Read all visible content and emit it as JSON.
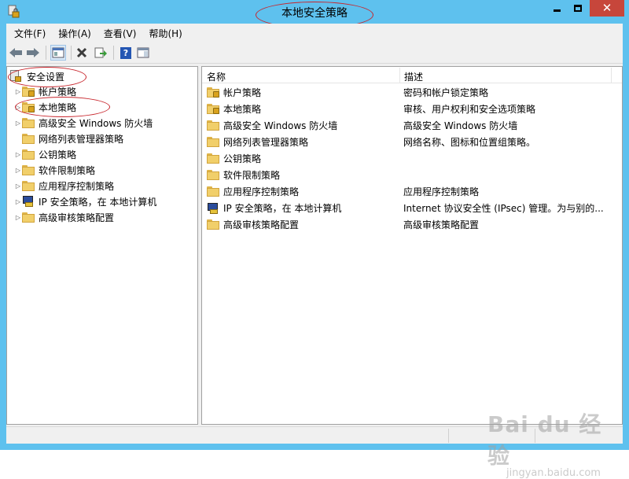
{
  "window": {
    "title": "本地安全策略",
    "close_glyph": "✕"
  },
  "menu": {
    "items": [
      "文件(F)",
      "操作(A)",
      "查看(V)",
      "帮助(H)"
    ]
  },
  "toolbar": {
    "icons": [
      "back-arrow-icon",
      "forward-arrow-icon",
      "show-hide-tree-icon",
      "delete-icon",
      "export-list-icon",
      "help-icon",
      "properties-icon"
    ],
    "help_glyph": "?"
  },
  "tree": {
    "root_label": "安全设置",
    "items": [
      {
        "label": "帐户策略",
        "icon": "locked-folder-icon"
      },
      {
        "label": "本地策略",
        "icon": "locked-folder-icon"
      },
      {
        "label": "高级安全 Windows 防火墙",
        "icon": "folder-icon"
      },
      {
        "label": "网络列表管理器策略",
        "icon": "folder-icon"
      },
      {
        "label": "公钥策略",
        "icon": "folder-icon"
      },
      {
        "label": "软件限制策略",
        "icon": "folder-icon"
      },
      {
        "label": "应用程序控制策略",
        "icon": "folder-icon"
      },
      {
        "label": "IP 安全策略，在 本地计算机",
        "icon": "ipsec-shield-icon"
      },
      {
        "label": "高级审核策略配置",
        "icon": "folder-icon"
      }
    ]
  },
  "list": {
    "columns": [
      "名称",
      "描述"
    ],
    "rows": [
      {
        "name": "帐户策略",
        "desc": "密码和帐户锁定策略",
        "icon": "locked-folder-icon"
      },
      {
        "name": "本地策略",
        "desc": "审核、用户权利和安全选项策略",
        "icon": "locked-folder-icon"
      },
      {
        "name": "高级安全 Windows 防火墙",
        "desc": "高级安全 Windows 防火墙",
        "icon": "folder-icon"
      },
      {
        "name": "网络列表管理器策略",
        "desc": "网络名称、图标和位置组策略。",
        "icon": "folder-icon"
      },
      {
        "name": "公钥策略",
        "desc": "",
        "icon": "folder-icon"
      },
      {
        "name": "软件限制策略",
        "desc": "",
        "icon": "folder-icon"
      },
      {
        "name": "应用程序控制策略",
        "desc": "应用程序控制策略",
        "icon": "folder-icon"
      },
      {
        "name": "IP 安全策略，在 本地计算机",
        "desc": "Internet 协议安全性 (IPsec) 管理。为与别的...",
        "icon": "ipsec-shield-icon"
      },
      {
        "name": "高级审核策略配置",
        "desc": "高级审核策略配置",
        "icon": "folder-icon"
      }
    ]
  },
  "watermark": {
    "main": "Bai du 经验",
    "sub": "jingyan.baidu.com"
  },
  "colors": {
    "title_bar": "#5ec1ee",
    "close_button": "#c7463b",
    "annotation_red": "#c8262d"
  }
}
